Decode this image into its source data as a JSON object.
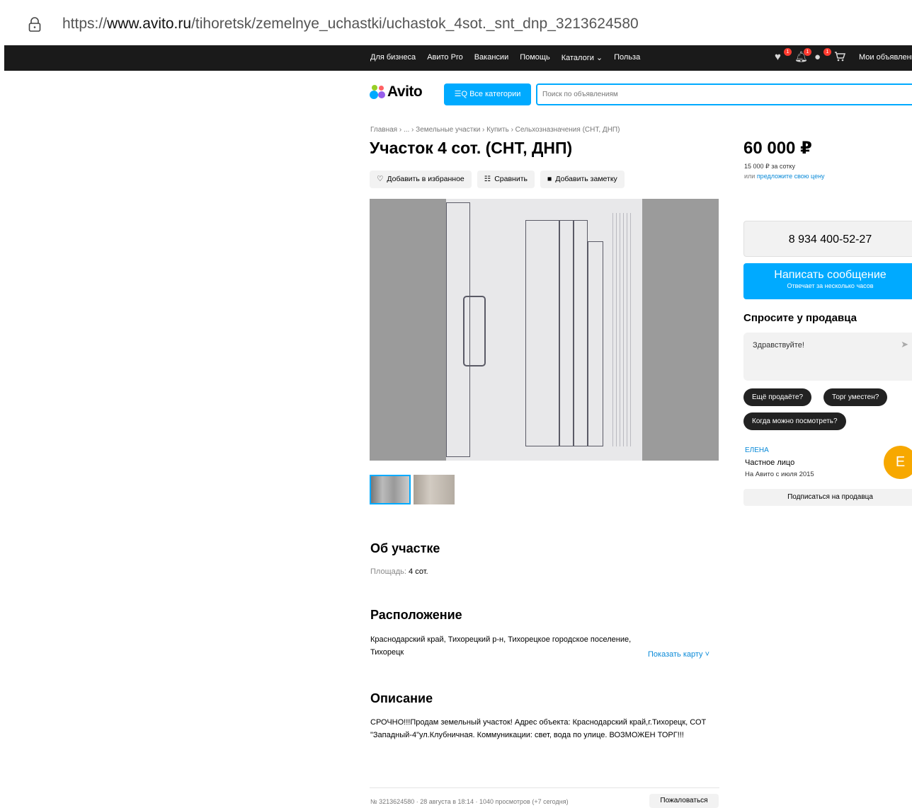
{
  "browser": {
    "url_prefix": "https://",
    "url_domain": "www.avito.ru",
    "url_path": "/tihoretsk/zemelnye_uchastki/uchastok_4sot._snt_dnp_3213624580"
  },
  "topnav": [
    "Для бизнеса",
    "Авито Pro",
    "Вакансии",
    "Помощь",
    "Каталоги ⌄",
    "Польза"
  ],
  "topbar_badges": [
    "1",
    "1",
    "1"
  ],
  "my_ads": "Мои объявления",
  "header": {
    "logo": "Avito",
    "categories_button": "☰Q Все категории",
    "search_placeholder": "Поиск по объявлениям"
  },
  "breadcrumb": "Главная › ... › Земельные участки › Купить › Сельхозназначения (СНТ, ДНП)",
  "title": "Участок 4 сот. (СНТ, ДНП)",
  "actions": {
    "favorite": "Добавить в избранное",
    "compare": "Сравнить",
    "note": "Добавить заметку"
  },
  "about": {
    "heading": "Об участке",
    "area_label": "Площадь:",
    "area_value": "4 сот."
  },
  "location": {
    "heading": "Расположение",
    "address": "Краснодарский край, Тихорецкий р-н, Тихорецкое городское поселение, Тихорецк",
    "show_map": "Показать карту ˅"
  },
  "description": {
    "heading": "Описание",
    "text": "СРОЧНО!!!Продам земельный участок! Адрес объекта: Краснодарский край,г.Тихорецк, СОТ \"Западный-4\"ул.Клубничная. Коммуникации: свет, вода по улице. ВОЗМОЖЕН ТОРГ!!!"
  },
  "footer": {
    "meta": "№ 3213624580 · 28 августа в 18:14 · 1040 просмотров (+7 сегодня)",
    "report": "Пожаловаться"
  },
  "sidebar": {
    "price": "60 000 ₽",
    "price_per": "15 000 ₽ за сотку",
    "offer_prefix": "или ",
    "offer_link": "предложите свою цену",
    "phone": "8 934 400-52-27",
    "message_button": "Написать сообщение",
    "message_sub": "Отвечает за несколько часов",
    "ask_heading": "Спросите у продавца",
    "ask_text": "Здравствуйте!",
    "chips": [
      "Ещё продаёте?",
      "Торг уместен?",
      "Когда можно посмотреть?"
    ],
    "seller_name": "ЕЛЕНА",
    "seller_type": "Частное лицо",
    "seller_since": "На Авито с июля 2015",
    "avatar_letter": "E",
    "subscribe": "Подписаться на продавца"
  },
  "colors": {
    "accent": "#00aaff",
    "link": "#0a8ad8",
    "avatar": "#f7a800",
    "topbar": "#1a1a1a"
  }
}
